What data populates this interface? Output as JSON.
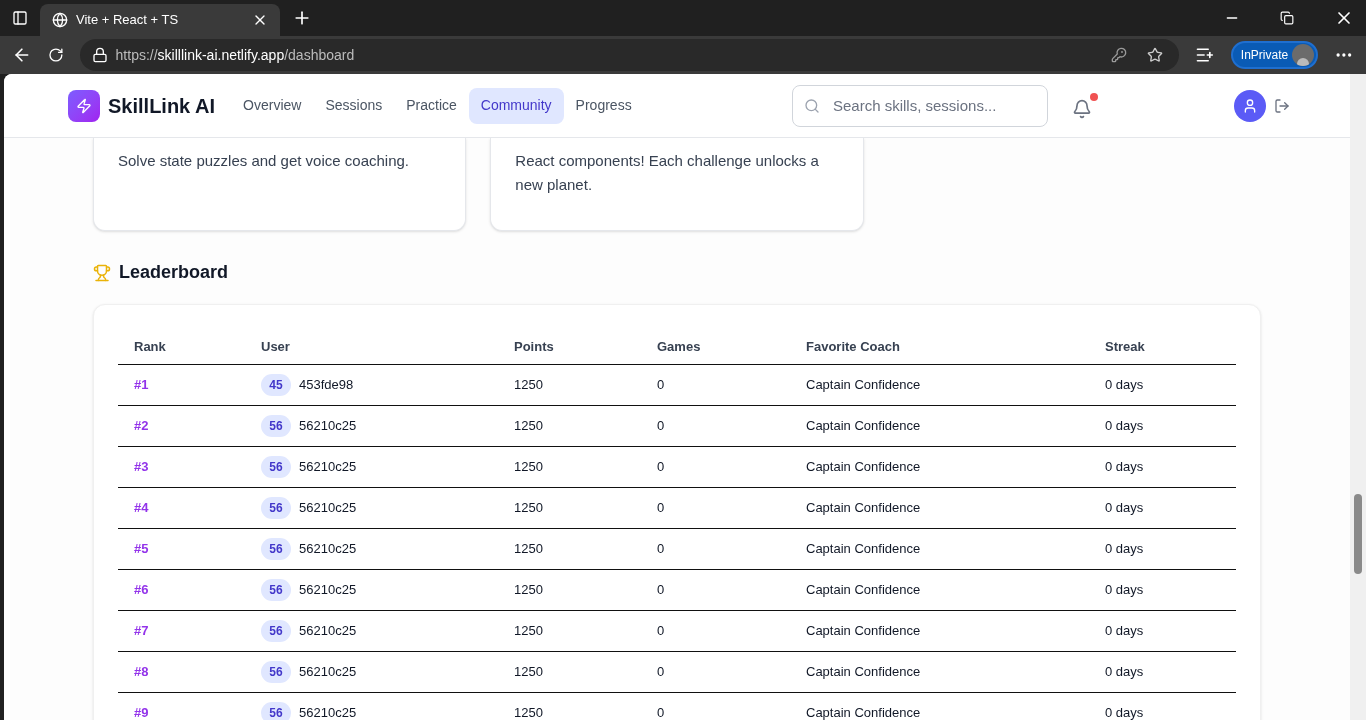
{
  "browser": {
    "tab_title": "Vite + React + TS",
    "url": {
      "scheme": "https://",
      "host": "skilllink-ai.netlify.app",
      "path": "/dashboard"
    },
    "profile_label": "InPrivate"
  },
  "header": {
    "brand": "SkillLink AI",
    "nav": [
      {
        "label": "Overview",
        "selected": false
      },
      {
        "label": "Sessions",
        "selected": false
      },
      {
        "label": "Practice",
        "selected": false
      },
      {
        "label": "Community",
        "selected": true
      },
      {
        "label": "Progress",
        "selected": false
      }
    ],
    "search": {
      "placeholder": "Search skills, sessions..."
    },
    "notifications": {
      "unread": true
    }
  },
  "cards": [
    {
      "lines": [
        "Solve state puzzles and get voice coaching."
      ]
    },
    {
      "lines": [
        "React components! Each challenge unlocks a",
        "new planet."
      ]
    }
  ],
  "leaderboard": {
    "title": "Leaderboard",
    "columns": [
      "Rank",
      "User",
      "Points",
      "Games",
      "Favorite Coach",
      "Streak"
    ],
    "rows": [
      {
        "rank": "#1",
        "badge": "45",
        "user": "453fde98",
        "points": "1250",
        "games": "0",
        "coach": "Captain Confidence",
        "streak": "0 days"
      },
      {
        "rank": "#2",
        "badge": "56",
        "user": "56210c25",
        "points": "1250",
        "games": "0",
        "coach": "Captain Confidence",
        "streak": "0 days"
      },
      {
        "rank": "#3",
        "badge": "56",
        "user": "56210c25",
        "points": "1250",
        "games": "0",
        "coach": "Captain Confidence",
        "streak": "0 days"
      },
      {
        "rank": "#4",
        "badge": "56",
        "user": "56210c25",
        "points": "1250",
        "games": "0",
        "coach": "Captain Confidence",
        "streak": "0 days"
      },
      {
        "rank": "#5",
        "badge": "56",
        "user": "56210c25",
        "points": "1250",
        "games": "0",
        "coach": "Captain Confidence",
        "streak": "0 days"
      },
      {
        "rank": "#6",
        "badge": "56",
        "user": "56210c25",
        "points": "1250",
        "games": "0",
        "coach": "Captain Confidence",
        "streak": "0 days"
      },
      {
        "rank": "#7",
        "badge": "56",
        "user": "56210c25",
        "points": "1250",
        "games": "0",
        "coach": "Captain Confidence",
        "streak": "0 days"
      },
      {
        "rank": "#8",
        "badge": "56",
        "user": "56210c25",
        "points": "1250",
        "games": "0",
        "coach": "Captain Confidence",
        "streak": "0 days"
      },
      {
        "rank": "#9",
        "badge": "56",
        "user": "56210c25",
        "points": "1250",
        "games": "0",
        "coach": "Captain Confidence",
        "streak": "0 days"
      }
    ]
  }
}
